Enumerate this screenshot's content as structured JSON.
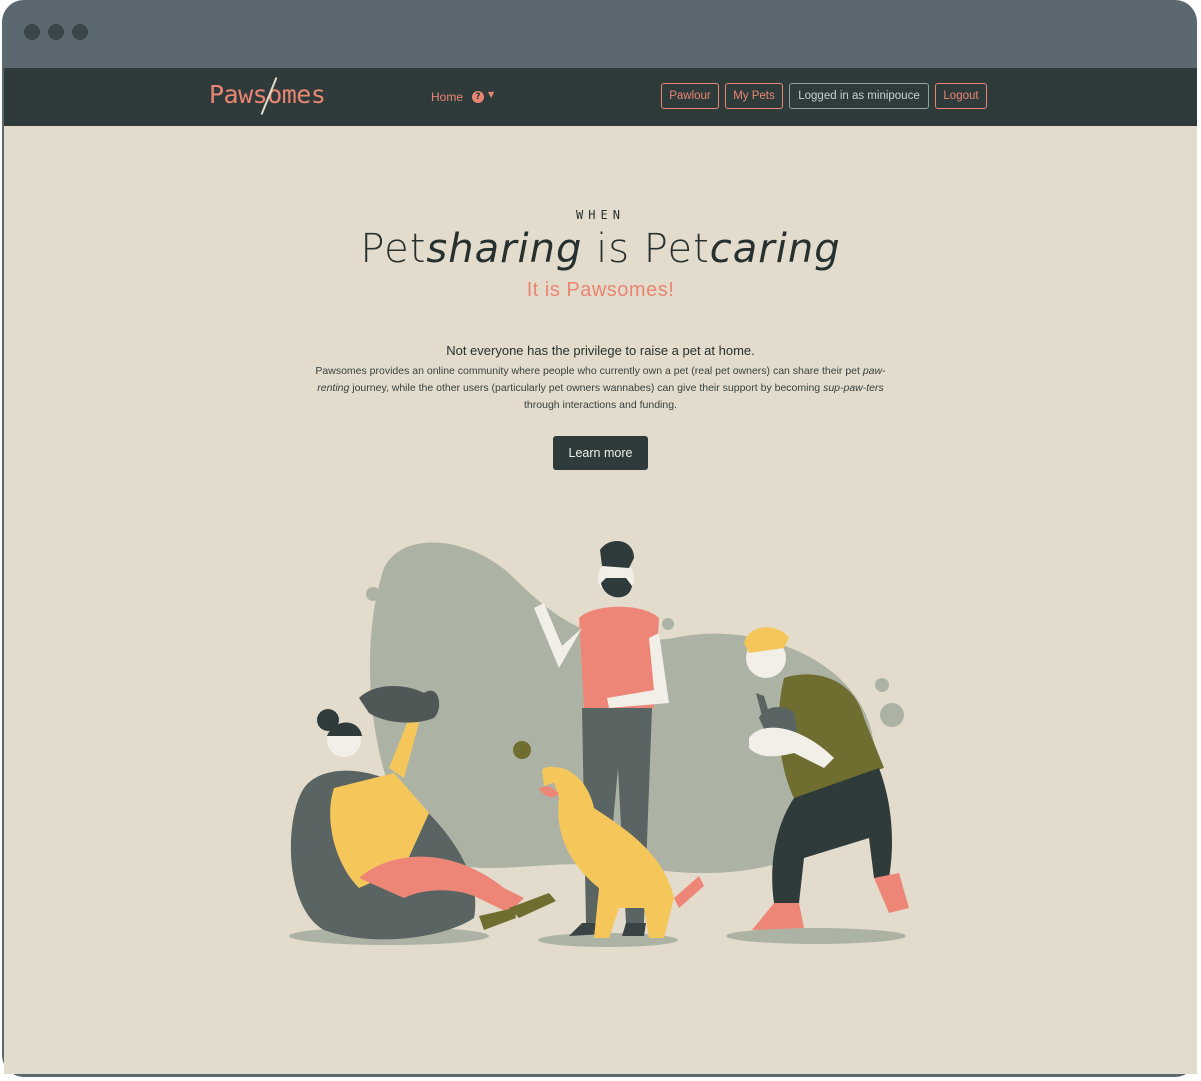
{
  "navbar": {
    "logo": "Pawsomes",
    "home_label": "Home",
    "help_icon": "?",
    "pawlour_label": "Pawlour",
    "mypets_label": "My Pets",
    "user_label": "Logged in as minipouce",
    "logout_label": "Logout"
  },
  "hero": {
    "kicker": "WHEN",
    "headline_pet1": "Pet",
    "headline_sharing": "sharing",
    "headline_is": " is ",
    "headline_pet2": "Pet",
    "headline_caring": "caring",
    "subtitle": "It is Pawsomes!",
    "lead": "Not everyone has the privilege to raise a pet at home.",
    "desc_1": "Pawsomes provides an online community where people who currently own a pet (real pet owners) can share their pet ",
    "desc_em1": "paw-renting",
    "desc_2": " journey, while the other users (particularly pet owners wannabes) can give their support by becoming ",
    "desc_em2": "sup-paw-ters",
    "desc_3": " through interactions and funding.",
    "cta_label": "Learn more"
  },
  "colors": {
    "navbar": "#2f3b3b",
    "accent": "#e98673",
    "background": "#e3dccc",
    "frame": "#5b686f"
  },
  "illustration": {
    "description_icon": "people-playing-with-pets-illustration"
  }
}
